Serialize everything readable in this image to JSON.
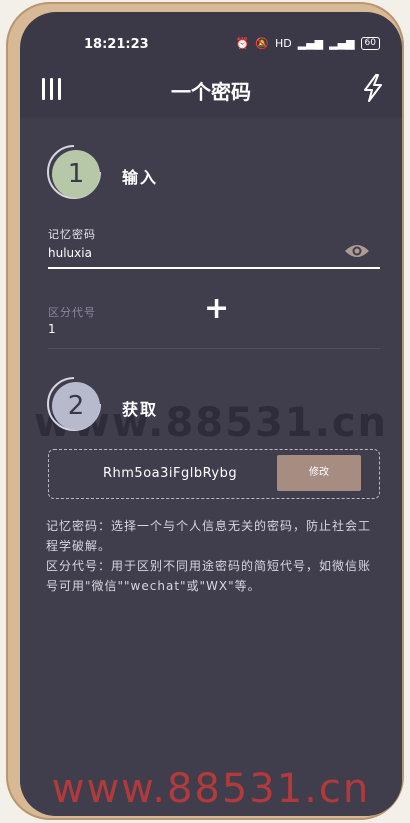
{
  "status": {
    "time": "18:21:23",
    "battery": "60",
    "signal_text": "HD"
  },
  "header": {
    "title": "一个密码"
  },
  "step1": {
    "number": "1",
    "label": "输入",
    "memory_label": "记忆密码",
    "memory_value": "huluxia",
    "code_label": "区分代号",
    "code_value": "1"
  },
  "step2": {
    "number": "2",
    "label": "获取",
    "result": "Rhm5oa3iFglbRybg",
    "edit_label": "修改"
  },
  "help": {
    "line1": "记忆密码：选择一个与个人信息无关的密码，防止社会工程学破解。",
    "line2": "区分代号：用于区别不同用途密码的简短代号，如微信账号可用\"微信\"\"wechat\"或\"WX\"等。"
  },
  "watermarks": {
    "top": "www.88531.cn",
    "bottom": "www.88531.cn"
  },
  "colors": {
    "background": "#3b3848",
    "step1_circle": "#b7c8a8",
    "step2_circle": "#b7bacd",
    "edit_button": "#a78c82",
    "watermark_top": "#2e2b3a",
    "watermark_bottom": "#b33a3a"
  }
}
